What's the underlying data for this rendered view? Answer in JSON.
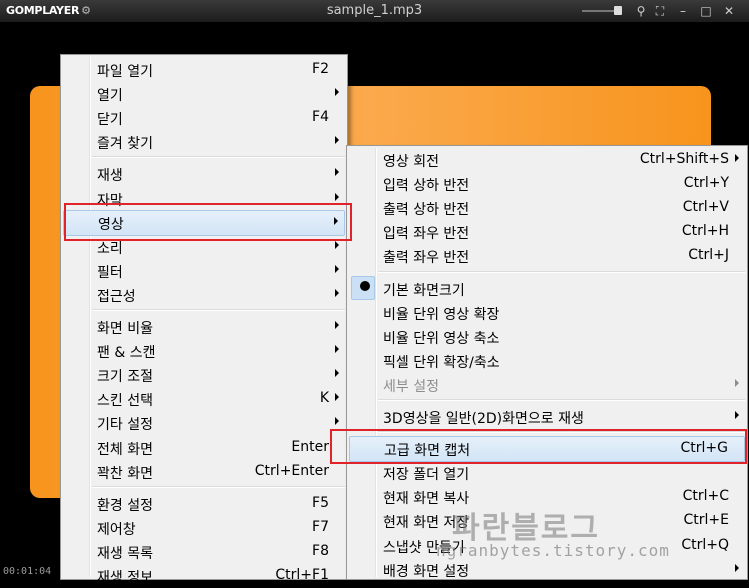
{
  "window": {
    "logo": "GOMPLAYER",
    "title": "sample_1.mp3",
    "elapsed": "00:01:04",
    "buttons": [
      "pin-icon",
      "fullscreen-icon",
      "minimize-icon",
      "maximize-icon",
      "close-icon"
    ]
  },
  "main_menu": {
    "groups": [
      [
        {
          "label": "파일 열기",
          "shortcut": "F2",
          "submenu": false
        },
        {
          "label": "열기",
          "shortcut": "",
          "submenu": true
        },
        {
          "label": "닫기",
          "shortcut": "F4",
          "submenu": false
        },
        {
          "label": "즐겨 찾기",
          "shortcut": "",
          "submenu": true
        }
      ],
      [
        {
          "label": "재생",
          "shortcut": "",
          "submenu": true
        },
        {
          "label": "자막",
          "shortcut": "",
          "submenu": true
        },
        {
          "label": "영상",
          "shortcut": "",
          "submenu": true,
          "highlighted": true
        },
        {
          "label": "소리",
          "shortcut": "",
          "submenu": true
        },
        {
          "label": "필터",
          "shortcut": "",
          "submenu": true
        },
        {
          "label": "접근성",
          "shortcut": "",
          "submenu": true
        }
      ],
      [
        {
          "label": "화면 비율",
          "shortcut": "",
          "submenu": true
        },
        {
          "label": "팬 & 스캔",
          "shortcut": "",
          "submenu": true
        },
        {
          "label": "크기 조절",
          "shortcut": "",
          "submenu": true
        },
        {
          "label": "스킨 선택",
          "shortcut": "K",
          "submenu": true
        },
        {
          "label": "기타 설정",
          "shortcut": "",
          "submenu": true
        },
        {
          "label": "전체 화면",
          "shortcut": "Enter",
          "submenu": false
        },
        {
          "label": "꽉찬 화면",
          "shortcut": "Ctrl+Enter",
          "submenu": false
        }
      ],
      [
        {
          "label": "환경 설정",
          "shortcut": "F5",
          "submenu": false
        },
        {
          "label": "제어창",
          "shortcut": "F7",
          "submenu": false
        },
        {
          "label": "재생 목록",
          "shortcut": "F8",
          "submenu": false
        },
        {
          "label": "재생 정보",
          "shortcut": "Ctrl+F1",
          "submenu": false
        }
      ]
    ]
  },
  "video_submenu": {
    "groups": [
      [
        {
          "label": "영상 회전",
          "shortcut": "Ctrl+Shift+S",
          "submenu": true
        },
        {
          "label": "입력 상하 반전",
          "shortcut": "Ctrl+Y",
          "submenu": false
        },
        {
          "label": "출력 상하 반전",
          "shortcut": "Ctrl+V",
          "submenu": false
        },
        {
          "label": "입력 좌우 반전",
          "shortcut": "Ctrl+H",
          "submenu": false
        },
        {
          "label": "출력 좌우 반전",
          "shortcut": "Ctrl+J",
          "submenu": false
        }
      ],
      [
        {
          "label": "기본 화면크기",
          "shortcut": "",
          "submenu": false,
          "radio_selected": true
        },
        {
          "label": "비율 단위 영상 확장",
          "shortcut": "",
          "submenu": false
        },
        {
          "label": "비율 단위 영상 축소",
          "shortcut": "",
          "submenu": false
        },
        {
          "label": "픽셀 단위 확장/축소",
          "shortcut": "",
          "submenu": false
        },
        {
          "label": "세부 설정",
          "shortcut": "",
          "submenu": true,
          "disabled": true
        }
      ],
      [
        {
          "label": "3D영상을 일반(2D)화면으로 재생",
          "shortcut": "",
          "submenu": true
        }
      ],
      [
        {
          "label": "고급 화면 캡처",
          "shortcut": "Ctrl+G",
          "submenu": false,
          "highlighted": true
        },
        {
          "label": "저장 폴더 열기",
          "shortcut": "",
          "submenu": false
        },
        {
          "label": "현재 화면 복사",
          "shortcut": "Ctrl+C",
          "submenu": false
        },
        {
          "label": "현재 화면 저장",
          "shortcut": "Ctrl+E",
          "submenu": false
        },
        {
          "label": "스냅샷 만들기",
          "shortcut": "Ctrl+Q",
          "submenu": false
        },
        {
          "label": "배경 화면 설정",
          "shortcut": "",
          "submenu": true
        }
      ]
    ]
  },
  "watermark": {
    "title": "파란블로그",
    "url": "ngranbytes.tistory.com"
  },
  "colors": {
    "video_orange": "#f7941d",
    "highlight_border": "#e0232b",
    "menu_bg": "#f0f0f0"
  }
}
